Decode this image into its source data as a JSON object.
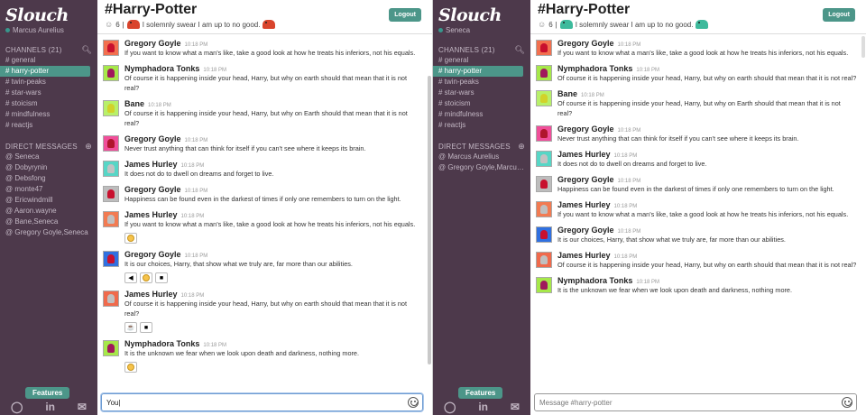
{
  "brand": "Slouch",
  "left": {
    "user": "Marcus Aurelius",
    "channels_header": "CHANNELS",
    "channels_count": "(21)",
    "channels": [
      "# general",
      "# harry-potter",
      "# twin-peaks",
      "# star-wars",
      "# stoicism",
      "# mindfulness",
      "# reactjs"
    ],
    "dm_header": "DIRECT MESSAGES",
    "dms": [
      "@ Seneca",
      "@ Dobyrynin",
      "@ Debsfong",
      "@ monte47",
      "@ Ericwindmill",
      "@ Aaron.wayne",
      "@ Bane,Seneca",
      "@ Gregory Goyle,Seneca"
    ],
    "title": "#Harry-Potter",
    "members": "6",
    "topic": "I solemnly swear I am up to no good.",
    "logout": "Logout",
    "features": "Features",
    "input_value": "You",
    "messages": [
      {
        "name": "Gregory Goyle",
        "time": "10:18 PM",
        "text": "If you want to know what a man's like, take a good look at how he treats his inferiors, not his equals.",
        "bg": "#f2704f",
        "fg": "#c8102e"
      },
      {
        "name": "Nymphadora Tonks",
        "time": "10:18 PM",
        "text": "Of course it is happening inside your head, Harry, but why on earth should that mean that it is not real?",
        "bg": "#a6e84a",
        "fg": "#a0195c"
      },
      {
        "name": "Bane",
        "time": "10:18 PM",
        "text": "Of course it is happening inside your head, Harry, but why on Earth should that mean that it is not real?",
        "bg": "#b8f06a",
        "fg": "#d2d22a"
      },
      {
        "name": "Gregory Goyle",
        "time": "10:18 PM",
        "text": "Never trust anything that can think for itself if you can't see where it keeps its brain.",
        "bg": "#f04f9a",
        "fg": "#b0152c"
      },
      {
        "name": "James Hurley",
        "time": "10:18 PM",
        "text": "It does not do to dwell on dreams and forget to live.",
        "bg": "#57d6c6",
        "fg": "#c2c2c2"
      },
      {
        "name": "Gregory Goyle",
        "time": "10:18 PM",
        "text": "Happiness can be found even in the darkest of times if only one remembers to turn on the light.",
        "bg": "#bdbdbd",
        "fg": "#c8102e"
      },
      {
        "name": "James Hurley",
        "time": "10:18 PM",
        "text": "If you want to know what a man's like, take a good look at how he treats his inferiors, not his equals.",
        "bg": "#f27b52",
        "fg": "#c0c0c0",
        "reacts": [
          "face"
        ]
      },
      {
        "name": "Gregory Goyle",
        "time": "10:18 PM",
        "text": "It is our choices, Harry, that show what we truly are, far more than our abilities.",
        "bg": "#3070e0",
        "fg": "#c8102e",
        "reacts": [
          "◀",
          "face",
          "■"
        ]
      },
      {
        "name": "James Hurley",
        "time": "10:18 PM",
        "text": "Of course it is happening inside your head, Harry, but why on earth should that mean that it is not real?",
        "bg": "#f06a4c",
        "fg": "#c0c0c0",
        "reacts": [
          "☕",
          "■"
        ]
      },
      {
        "name": "Nymphadora Tonks",
        "time": "10:18 PM",
        "text": "It is the unknown we fear when we look upon death and darkness, nothing more.",
        "bg": "#a6e84a",
        "fg": "#a0195c",
        "reacts": [
          "face"
        ]
      }
    ]
  },
  "right": {
    "user": "Seneca",
    "channels_header": "CHANNELS",
    "channels_count": "(21)",
    "channels": [
      "# general",
      "# harry-potter",
      "# twin-peaks",
      "# star-wars",
      "# stoicism",
      "# mindfulness",
      "# reactjs"
    ],
    "dm_header": "DIRECT MESSAGES",
    "dms": [
      "@ Marcus Aurelius",
      "@ Gregory Goyle,Marcus A..."
    ],
    "title": "#Harry-Potter",
    "members": "6",
    "topic": "I solemnly swear I am up to no good.",
    "logout": "Logout",
    "features": "Features",
    "input_placeholder": "Message #harry-potter",
    "messages": [
      {
        "name": "Gregory Goyle",
        "time": "10:18 PM",
        "text": "If you want to know what a man's like, take a good look at how he treats his inferiors, not his equals.",
        "bg": "#f2704f",
        "fg": "#c8102e"
      },
      {
        "name": "Nymphadora Tonks",
        "time": "10:18 PM",
        "text": "Of course it is happening inside your head, Harry, but why on earth should that mean that it is not real?",
        "bg": "#a6e84a",
        "fg": "#a0195c"
      },
      {
        "name": "Bane",
        "time": "10:18 PM",
        "text": "Of course it is happening inside your head, Harry, but why on Earth should that mean that it is not real?",
        "bg": "#b8f06a",
        "fg": "#d2d22a"
      },
      {
        "name": "Gregory Goyle",
        "time": "10:18 PM",
        "text": "Never trust anything that can think for itself if you can't see where it keeps its brain.",
        "bg": "#f04f9a",
        "fg": "#b0152c"
      },
      {
        "name": "James Hurley",
        "time": "10:18 PM",
        "text": "It does not do to dwell on dreams and forget to live.",
        "bg": "#57d6c6",
        "fg": "#c2c2c2"
      },
      {
        "name": "Gregory Goyle",
        "time": "10:18 PM",
        "text": "Happiness can be found even in the darkest of times if only one remembers to turn on the light.",
        "bg": "#bdbdbd",
        "fg": "#c8102e"
      },
      {
        "name": "James Hurley",
        "time": "10:18 PM",
        "text": "If you want to know what a man's like, take a good look at how he treats his inferiors, not his equals.",
        "bg": "#f27b52",
        "fg": "#c0c0c0"
      },
      {
        "name": "Gregory Goyle",
        "time": "10:18 PM",
        "text": "It is our choices, Harry, that show what we truly are, far more than our abilities.",
        "bg": "#3070e0",
        "fg": "#c8102e"
      },
      {
        "name": "James Hurley",
        "time": "10:18 PM",
        "text": "Of course it is happening inside your head, Harry, but why on earth should that mean that it is not real?",
        "bg": "#f06a4c",
        "fg": "#c0c0c0"
      },
      {
        "name": "Nymphadora Tonks",
        "time": "10:18 PM",
        "text": "It is the unknown we fear when we look upon death and darkness, nothing more.",
        "bg": "#a6e84a",
        "fg": "#a0195c"
      }
    ]
  },
  "social": [
    "github-icon",
    "linkedin-icon",
    "mail-icon"
  ],
  "colors": {
    "sidebar": "#4d394b",
    "accent": "#4c9689"
  }
}
